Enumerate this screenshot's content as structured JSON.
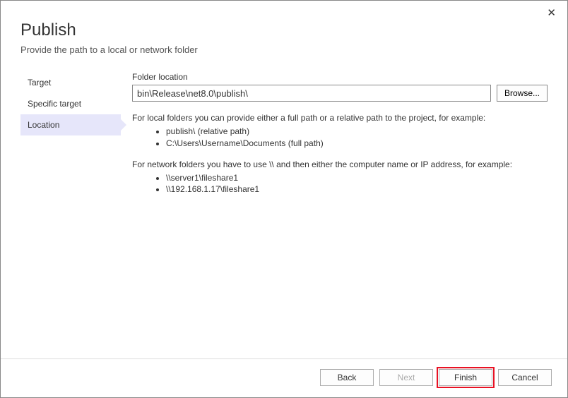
{
  "close": "✕",
  "header": {
    "title": "Publish",
    "subtitle": "Provide the path to a local or network folder"
  },
  "sidebar": {
    "items": [
      {
        "label": "Target"
      },
      {
        "label": "Specific target"
      },
      {
        "label": "Location"
      }
    ]
  },
  "main": {
    "folderLabel": "Folder location",
    "folderValue": "bin\\Release\\net8.0\\publish\\",
    "browseLabel": "Browse...",
    "help1": "For local folders you can provide either a full path or a relative path to the project, for example:",
    "help1_items": [
      "publish\\ (relative path)",
      "C:\\Users\\Username\\Documents (full path)"
    ],
    "help2": "For network folders you have to use \\\\ and then either the computer name or IP address, for example:",
    "help2_items": [
      "\\\\server1\\fileshare1",
      "\\\\192.168.1.17\\fileshare1"
    ]
  },
  "buttons": {
    "back": "Back",
    "next": "Next",
    "finish": "Finish",
    "cancel": "Cancel"
  }
}
